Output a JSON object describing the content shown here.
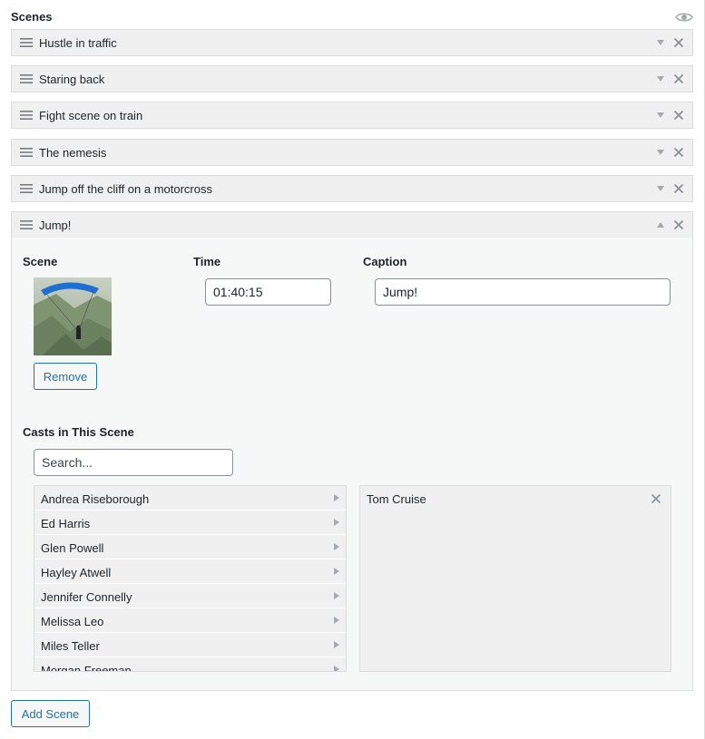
{
  "section": {
    "title": "Scenes",
    "visibility_icon": "eye-icon"
  },
  "scenes": [
    {
      "title": "Hustle in traffic",
      "expanded": false
    },
    {
      "title": "Staring back",
      "expanded": false
    },
    {
      "title": "Fight scene on train",
      "expanded": false
    },
    {
      "title": "The nemesis",
      "expanded": false
    },
    {
      "title": "Jump off the cliff on a motorcross",
      "expanded": false
    },
    {
      "title": "Jump!",
      "expanded": true
    }
  ],
  "expanded_scene": {
    "scene_label": "Scene",
    "time_label": "Time",
    "caption_label": "Caption",
    "time_value": "01:40:15",
    "caption_value": "Jump!",
    "remove_label": "Remove",
    "casts_label": "Casts in This Scene",
    "search_placeholder": "Search...",
    "available_casts": [
      "Andrea Riseborough",
      "Ed Harris",
      "Glen Powell",
      "Hayley Atwell",
      "Jennifer Connelly",
      "Melissa Leo",
      "Miles Teller",
      "Morgan Freeman"
    ],
    "selected_casts": [
      "Tom Cruise"
    ]
  },
  "add_scene_label": "Add Scene",
  "colors": {
    "accent": "#2271b1",
    "row_bg": "#f0f0f1",
    "panel_bg": "#f6f7f7",
    "border": "#dcdcde"
  }
}
